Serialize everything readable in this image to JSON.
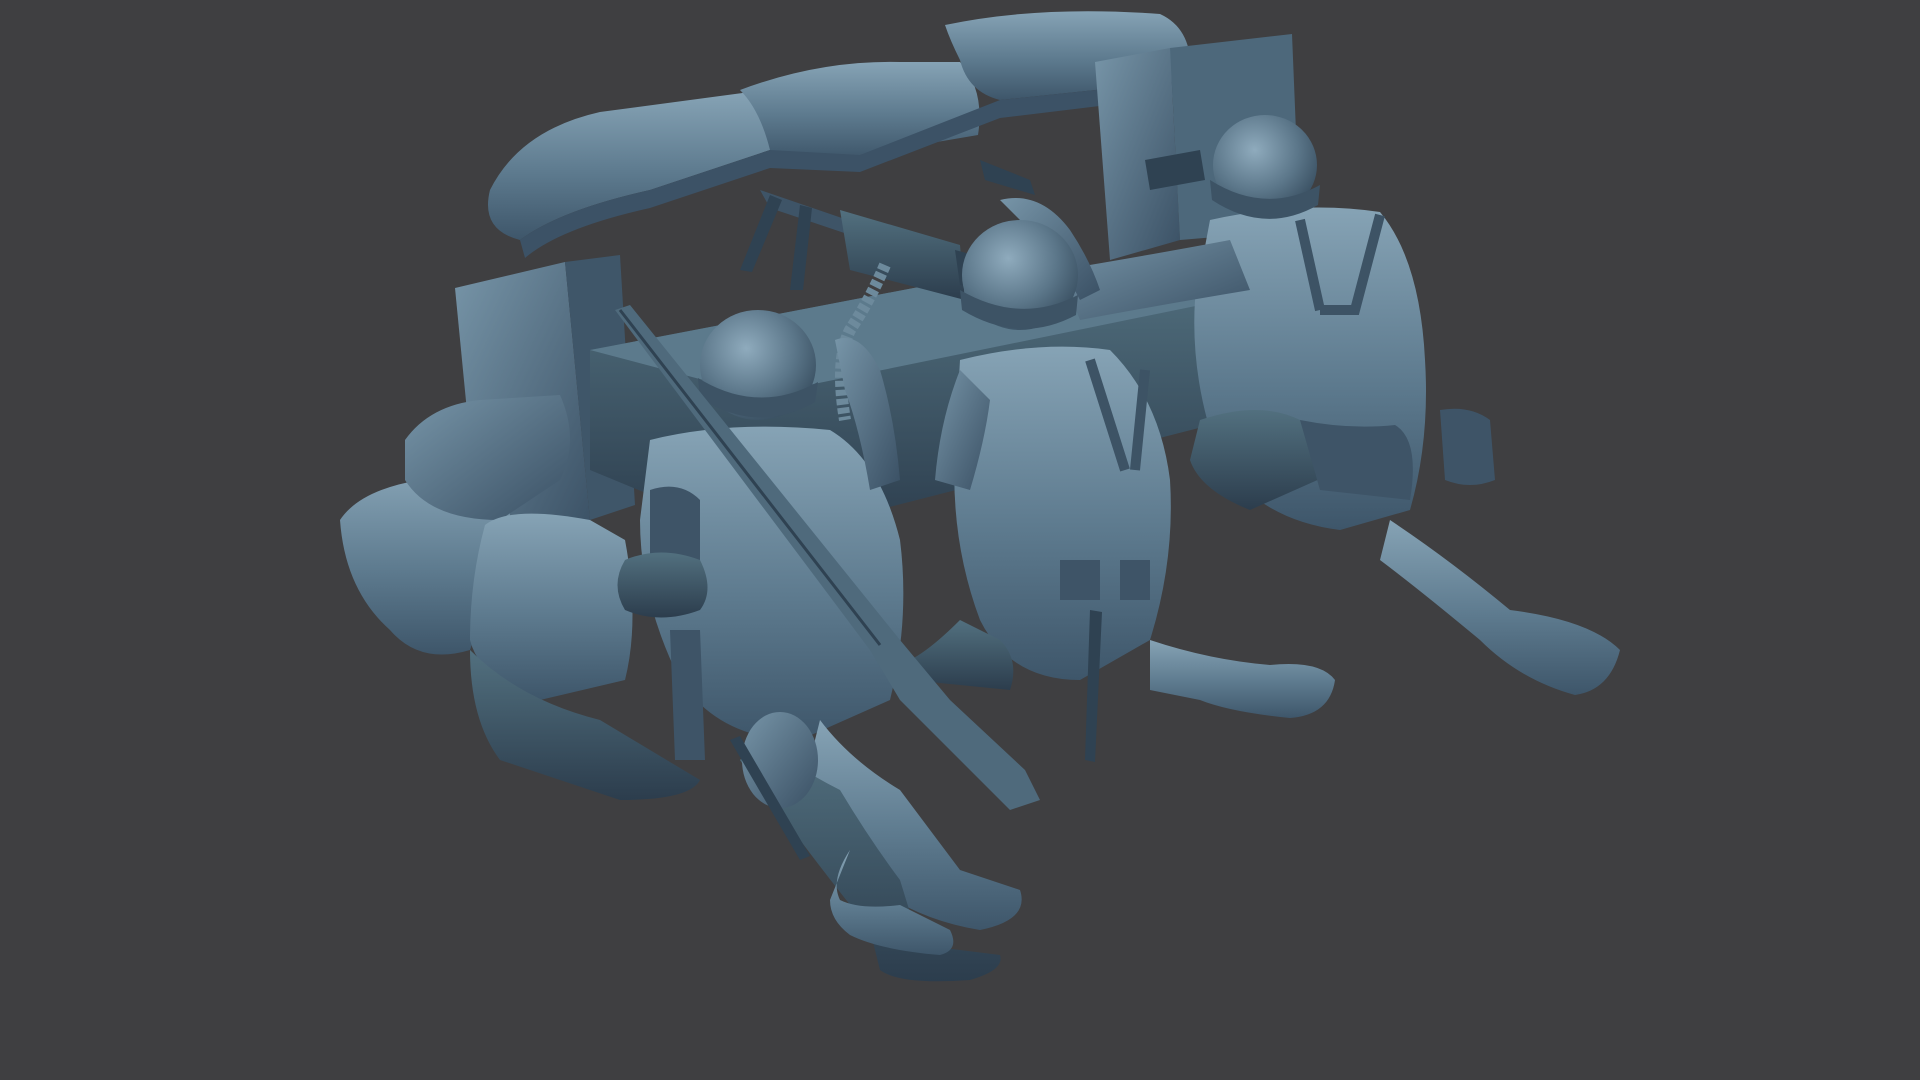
{
  "scene": {
    "background_color": "#3f3f41",
    "model_color": "#5d7a8e",
    "model_highlight_color": "#86a3b5",
    "model_shadow_color": "#32465a",
    "objects": [
      "sandbag-wall",
      "wooden-plank",
      "machine-gun",
      "ammo-belt",
      "ammo-crate",
      "soldier-left",
      "soldier-middle",
      "soldier-right",
      "rifle",
      "canteen",
      "bedroll",
      "gas-mask-canister",
      "bayonet"
    ]
  }
}
